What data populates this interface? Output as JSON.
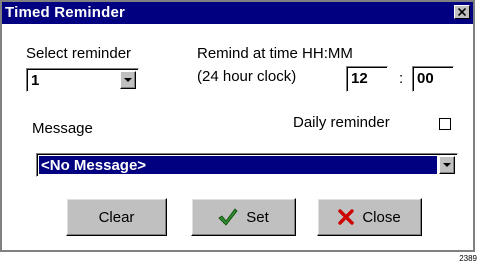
{
  "window": {
    "title": "Timed Reminder",
    "close_glyph": "✕"
  },
  "select_reminder": {
    "label": "Select reminder",
    "value": "1"
  },
  "remind_time": {
    "label": "Remind at time HH:MM",
    "sublabel": "(24 hour clock)",
    "hour": "12",
    "separator": ":",
    "minute": "00"
  },
  "message": {
    "label": "Message",
    "value": "<No Message>"
  },
  "daily_reminder": {
    "label": "Daily reminder",
    "checked": false
  },
  "buttons": {
    "clear": "Clear",
    "set": "Set",
    "close": "Close"
  },
  "figure_number": "2389",
  "colors": {
    "titlebar": "#000080",
    "face": "#c0c0c0",
    "check_icon": "#2e8b2e",
    "x_icon": "#cc0000"
  }
}
